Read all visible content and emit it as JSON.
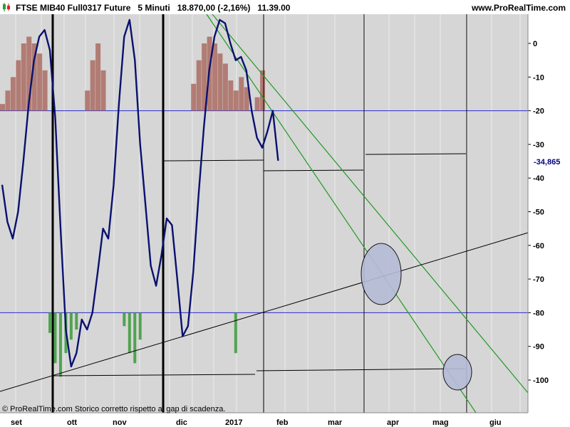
{
  "header": {
    "title": "FTSE MIB40 Full0317 Future   5 Minuti   18.870,00 (-2,16%)   11.39.00",
    "site": "www.ProRealTime.com"
  },
  "footer_note": "© ProRealTime.com  Storico corretto rispetto al gap di scadenza.",
  "colors": {
    "background": "#d6d6d6",
    "indicator_line": "#0a1070",
    "positive_histogram": "#a8655b",
    "negative_histogram": "#3a9a3a",
    "reference_lines": "#2a2ad0",
    "trendlines_green": "#229922",
    "trendlines_black": "#000000",
    "ellipse_fill": "#b6bcd8"
  },
  "chart_data": {
    "type": "line",
    "x_labels": [
      "set",
      "ott",
      "nov",
      "dic",
      "2017",
      "feb",
      "mar",
      "apr",
      "mag",
      "giu"
    ],
    "y_ticks": [
      0,
      -10,
      -20,
      -30,
      -40,
      -50,
      -60,
      -70,
      -80,
      -90,
      -100
    ],
    "ylim": [
      -103,
      12
    ],
    "last_value": "-34,865",
    "reference_levels": [
      -20,
      -80
    ],
    "series": [
      {
        "values": [
          [
            0,
            -42
          ],
          [
            1,
            -53
          ],
          [
            2,
            -58
          ],
          [
            3,
            -50
          ],
          [
            4,
            -35
          ],
          [
            5,
            -18
          ],
          [
            6,
            -5
          ],
          [
            7,
            2
          ],
          [
            8,
            4
          ],
          [
            9,
            -2
          ],
          [
            10,
            -22
          ],
          [
            11,
            -55
          ],
          [
            12,
            -85
          ],
          [
            13,
            -96
          ],
          [
            14,
            -92
          ],
          [
            15,
            -82
          ],
          [
            16,
            -85
          ],
          [
            17,
            -80
          ],
          [
            18,
            -68
          ],
          [
            19,
            -55
          ],
          [
            20,
            -58
          ],
          [
            21,
            -42
          ],
          [
            22,
            -18
          ],
          [
            23,
            2
          ],
          [
            24,
            7
          ],
          [
            25,
            -5
          ],
          [
            26,
            -30
          ],
          [
            27,
            -48
          ],
          [
            28,
            -66
          ],
          [
            29,
            -72
          ],
          [
            30,
            -63
          ],
          [
            31,
            -52
          ],
          [
            32,
            -54
          ],
          [
            33,
            -70
          ],
          [
            34,
            -87
          ],
          [
            35,
            -84
          ],
          [
            36,
            -68
          ],
          [
            37,
            -45
          ],
          [
            38,
            -25
          ],
          [
            39,
            -8
          ],
          [
            40,
            2
          ],
          [
            41,
            7
          ],
          [
            42,
            6
          ],
          [
            43,
            0
          ],
          [
            44,
            -5
          ],
          [
            45,
            -4
          ],
          [
            46,
            -8
          ],
          [
            47,
            -20
          ],
          [
            48,
            -28
          ],
          [
            49,
            -31
          ],
          [
            50,
            -26
          ],
          [
            51,
            -20
          ],
          [
            52,
            -34.865
          ]
        ]
      },
      {
        "name": "positive histogram",
        "values": [
          [
            0,
            -18
          ],
          [
            1,
            -14
          ],
          [
            2,
            -10
          ],
          [
            3,
            -5
          ],
          [
            4,
            0
          ],
          [
            5,
            2
          ],
          [
            6,
            0
          ],
          [
            7,
            -3
          ],
          [
            8,
            -8
          ],
          [
            16,
            -14
          ],
          [
            17,
            -5
          ],
          [
            18,
            0
          ],
          [
            19,
            -8
          ],
          [
            36,
            -12
          ],
          [
            37,
            -5
          ],
          [
            38,
            0
          ],
          [
            39,
            2
          ],
          [
            40,
            0
          ],
          [
            41,
            -3
          ],
          [
            42,
            -6
          ],
          [
            43,
            -11
          ],
          [
            44,
            -14
          ],
          [
            45,
            -10
          ],
          [
            46,
            -13
          ],
          [
            48,
            -16
          ],
          [
            49,
            -8
          ]
        ]
      },
      {
        "name": "negative histogram",
        "values": [
          [
            9,
            -86
          ],
          [
            10,
            -95
          ],
          [
            11,
            -99
          ],
          [
            12,
            -92
          ],
          [
            13,
            -88
          ],
          [
            14,
            -85
          ],
          [
            23,
            -84
          ],
          [
            24,
            -92
          ],
          [
            25,
            -95
          ],
          [
            26,
            -88
          ],
          [
            44,
            -92
          ]
        ]
      }
    ]
  }
}
